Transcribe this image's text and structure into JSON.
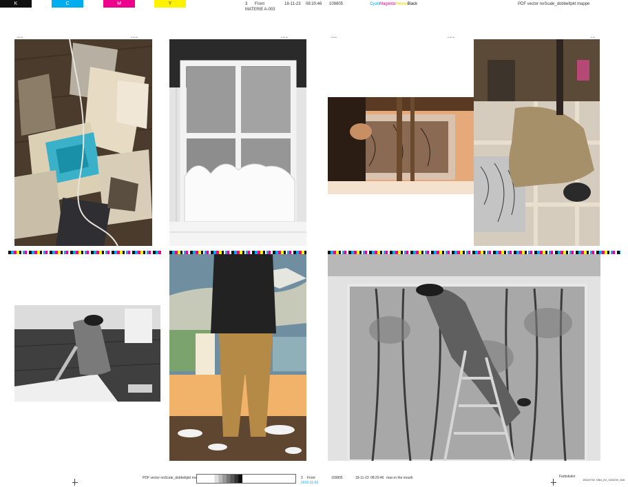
{
  "colors": {
    "black": "#111111",
    "cyan": "#00aeef",
    "magenta": "#ec008c",
    "yellow": "#fff200"
  },
  "top_slug": {
    "swatches": [
      "K",
      "C",
      "M",
      "Y"
    ],
    "page_no": "3",
    "side": "Front",
    "job_name": "MATERIE A-003",
    "date": "18-11-23",
    "time": "08:20:46",
    "job_no": "109805",
    "separations": {
      "cyan": "Cyan",
      "magenta": "Magenta",
      "yellow": "Yellow",
      "black": "Black"
    },
    "preset": "PDF vector noScale_dobbeltpkt mappe"
  },
  "bottom_slug": {
    "preset": "PDF vector noScale_dobbeltpkt mappe",
    "page_no": "3",
    "side": "Front",
    "plate_info": "2016-11-02",
    "job_no": "109805",
    "date": "18-11-23",
    "time": "08:20:46",
    "title": "man in the mouth",
    "right_label": "Farbskalor",
    "right_code1": "15024730",
    "right_code2": "KBA_6V_1024/3V_6x8"
  },
  "photos": [
    {
      "subject": "studio floor with scattered paintings"
    },
    {
      "subject": "canvas stretcher frame leaning on wall"
    },
    {
      "subject": "artist painting in warm light"
    },
    {
      "subject": "artist seen from above at easel"
    },
    {
      "subject": "artist kneeling painting canvas on floor"
    },
    {
      "subject": "artist standing before painting"
    },
    {
      "subject": "artist on ladder painting trees mural"
    }
  ]
}
